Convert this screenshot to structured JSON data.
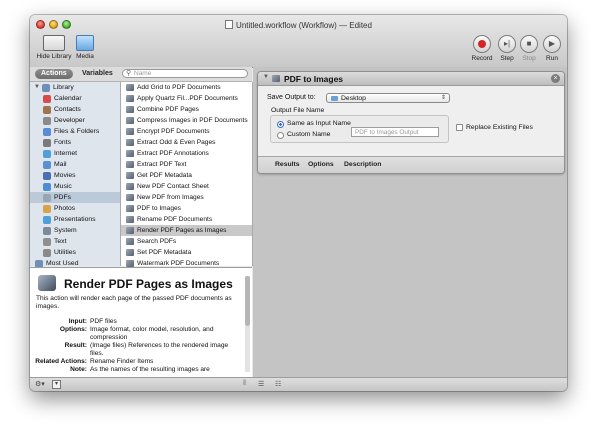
{
  "window": {
    "title": "Untitled.workflow (Workflow) — Edited"
  },
  "toolbar": {
    "hide_library": "Hide Library",
    "media": "Media",
    "record": "Record",
    "step": "Step",
    "stop": "Stop",
    "run": "Run"
  },
  "library_tabs": {
    "actions": "Actions",
    "variables": "Variables",
    "search_placeholder": "Name"
  },
  "library": {
    "items": [
      {
        "label": "Library",
        "icon": "library-folder-icon"
      },
      {
        "label": "Calendar",
        "icon": "calendar-icon"
      },
      {
        "label": "Contacts",
        "icon": "contacts-icon"
      },
      {
        "label": "Developer",
        "icon": "developer-icon"
      },
      {
        "label": "Files & Folders",
        "icon": "finder-icon"
      },
      {
        "label": "Fonts",
        "icon": "fonts-icon"
      },
      {
        "label": "Internet",
        "icon": "internet-icon"
      },
      {
        "label": "Mail",
        "icon": "mail-icon"
      },
      {
        "label": "Movies",
        "icon": "movies-icon"
      },
      {
        "label": "Music",
        "icon": "music-icon"
      },
      {
        "label": "PDFs",
        "icon": "pdf-icon"
      },
      {
        "label": "Photos",
        "icon": "photos-icon"
      },
      {
        "label": "Presentations",
        "icon": "presentations-icon"
      },
      {
        "label": "System",
        "icon": "system-icon"
      },
      {
        "label": "Text",
        "icon": "text-icon"
      },
      {
        "label": "Utilities",
        "icon": "utilities-icon"
      },
      {
        "label": "Most Used",
        "icon": "most-used-folder-icon"
      }
    ],
    "selected": "PDFs"
  },
  "actions": {
    "items": [
      "Add Grid to PDF Documents",
      "Apply Quartz Fil...PDF Documents",
      "Combine PDF Pages",
      "Compress Images in PDF Documents",
      "Encrypt PDF Documents",
      "Extract Odd & Even Pages",
      "Extract PDF Annotations",
      "Extract PDF Text",
      "Get PDF Metadata",
      "New PDF Contact Sheet",
      "New PDF from Images",
      "PDF to Images",
      "Rename PDF Documents",
      "Render PDF Pages as Images",
      "Search PDFs",
      "Set PDF Metadata",
      "Watermark PDF Documents"
    ],
    "selected": "Render PDF Pages as Images"
  },
  "detail": {
    "title": "Render PDF Pages as Images",
    "description": "This action will render each page of the passed PDF documents as images.",
    "rows": [
      {
        "key": "Input:",
        "value": "PDF files"
      },
      {
        "key": "Options:",
        "value": "Image format, color model, resolution, and compression"
      },
      {
        "key": "Result:",
        "value": "(Image files) References to the rendered image files."
      },
      {
        "key": "Related Actions:",
        "value": "Rename Finder Items"
      },
      {
        "key": "Note:",
        "value": "As the names of the resulting images are"
      }
    ]
  },
  "workflow_card": {
    "title": "PDF to Images",
    "save_output_label": "Save Output to:",
    "save_output_value": "Desktop",
    "output_file_name_label": "Output File Name",
    "radio_same": "Same as Input Name",
    "radio_custom": "Custom Name",
    "custom_name_placeholder": "PDF to Images Output",
    "replace_existing": "Replace Existing Files",
    "tabs": [
      "Results",
      "Options",
      "Description"
    ]
  },
  "colors": {
    "record": "#d42525",
    "selection": "#bcc9d9"
  }
}
